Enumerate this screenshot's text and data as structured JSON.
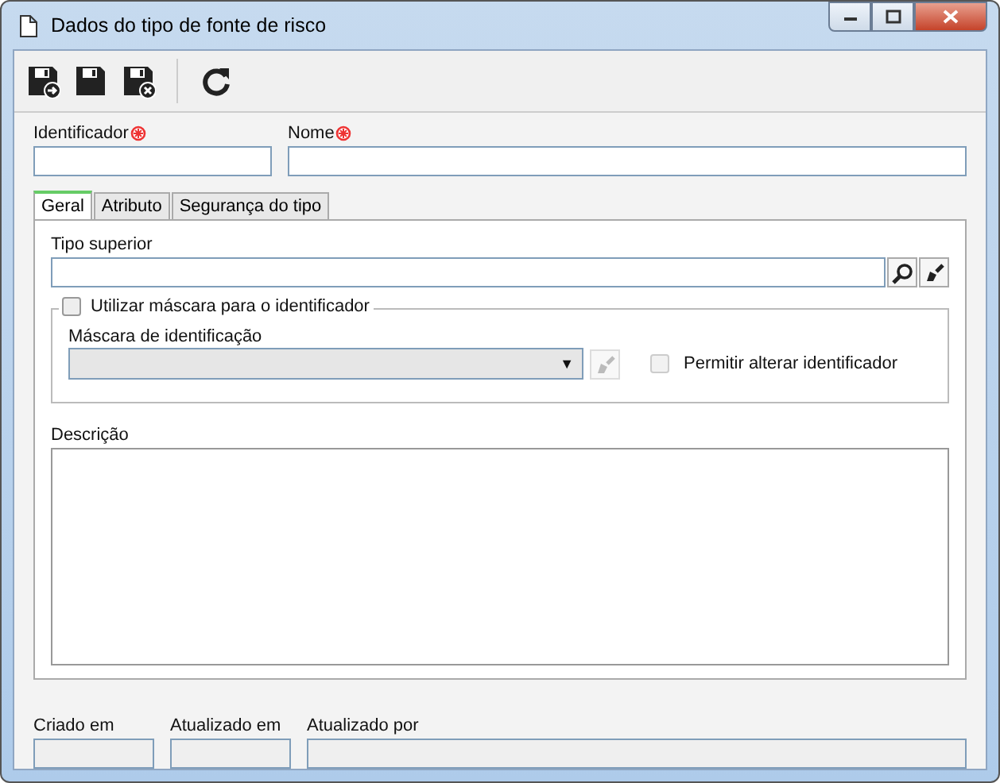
{
  "window": {
    "title": "Dados do tipo de fonte de risco"
  },
  "toolbar": [
    {
      "kind": "save-new"
    },
    {
      "kind": "save"
    },
    {
      "kind": "save-close"
    },
    {
      "kind": "refresh"
    }
  ],
  "header_fields": [
    {
      "label": "Identificador",
      "required": true
    },
    {
      "label": "Nome",
      "required": true
    }
  ],
  "tabs": [
    {
      "label": "Geral",
      "selected": true
    },
    {
      "label": "Atributo",
      "selected": false
    },
    {
      "label": "Segurança do tipo",
      "selected": false
    }
  ],
  "tipo_superior": {
    "label": "Tipo superior"
  },
  "mask_group": {
    "label": "Utilizar máscara para o identificador",
    "checked": false,
    "field_label": "Máscara de identificação",
    "disabled": true,
    "dropdown_arrow": "▼",
    "allow_change": {
      "label": "Permitir alterar identificador",
      "checked": false,
      "disabled": true
    }
  },
  "descricao": {
    "label": "Descrição"
  },
  "footer_fields": [
    {
      "label": "Criado em"
    },
    {
      "label": "Atualizado em"
    },
    {
      "label": "Atualizado por"
    }
  ]
}
